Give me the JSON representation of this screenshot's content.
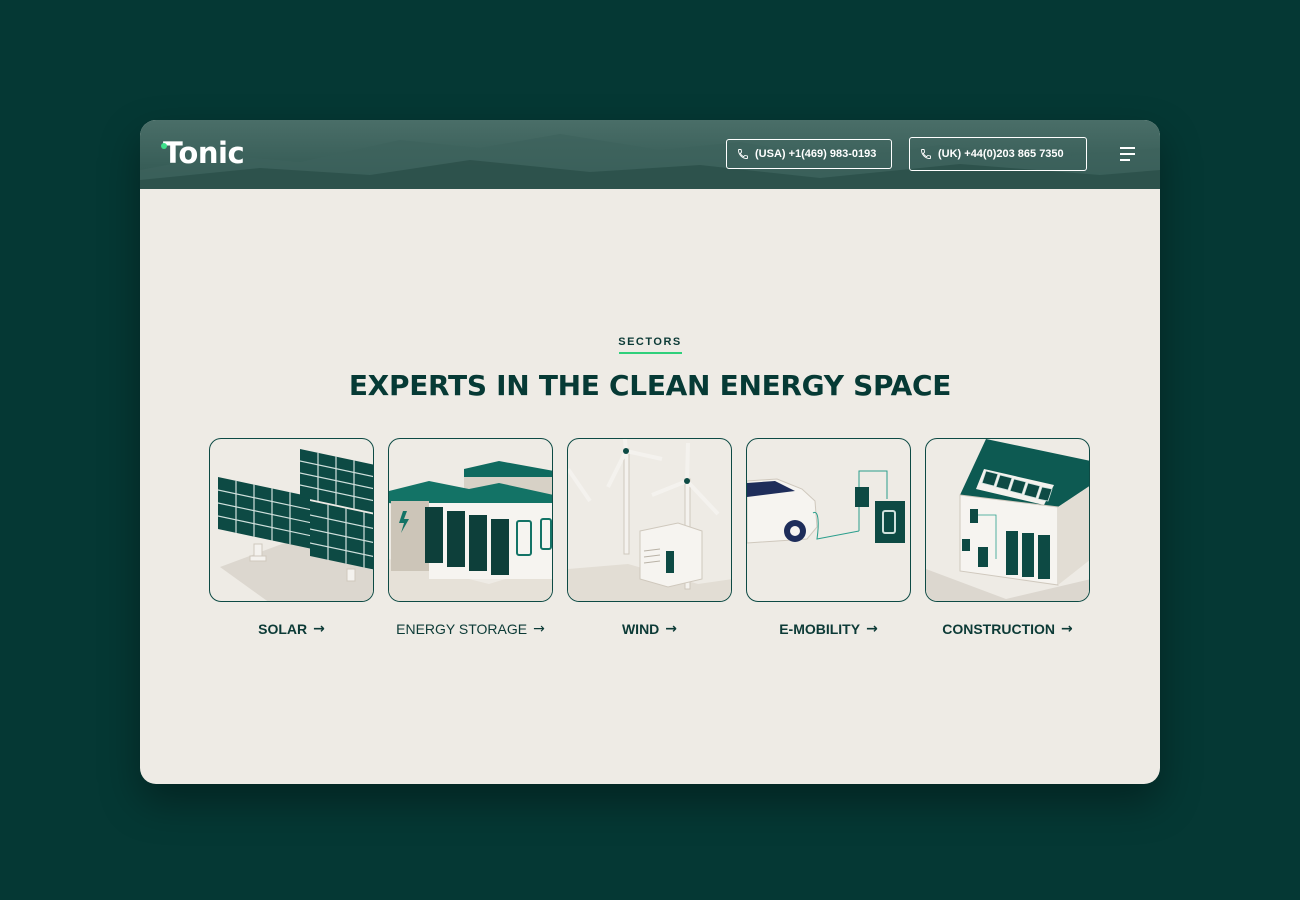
{
  "brand": {
    "logo_text": "Tonic"
  },
  "header": {
    "phone_usa": "(USA) +1(469) 983-0193",
    "phone_uk": "(UK) +44(0)203 865 7350"
  },
  "section": {
    "eyebrow": "SECTORS",
    "headline": "EXPERTS IN THE CLEAN ENERGY SPACE"
  },
  "sectors": [
    {
      "label": "SOLAR",
      "arrow": "→"
    },
    {
      "label": "ENERGY STORAGE",
      "arrow": "→"
    },
    {
      "label": "WIND",
      "arrow": "→"
    },
    {
      "label": "E-MOBILITY",
      "arrow": "→"
    },
    {
      "label": "CONSTRUCTION",
      "arrow": "→"
    }
  ],
  "colors": {
    "background": "#053834",
    "panel": "#eeebe5",
    "accent": "#2fd07b",
    "brand_dark": "#0c3a36"
  }
}
